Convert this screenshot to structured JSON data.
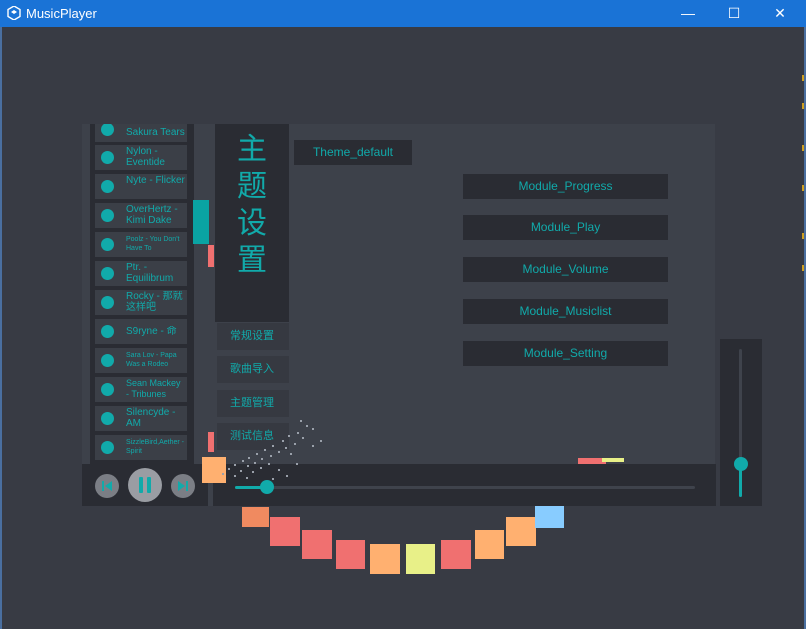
{
  "window": {
    "title": "MusicPlayer",
    "minimize_glyph": "—",
    "maximize_glyph": "☐",
    "close_glyph": "✕"
  },
  "music_list": {
    "items": [
      {
        "label": "Sakura Tears",
        "dot_color": "#11aaaa"
      },
      {
        "label": "Nylon - Eventide",
        "dot_color": "#11aaaa"
      },
      {
        "label": "Nyte - Flicker",
        "dot_color": "#11aaaa"
      },
      {
        "label": "OverHertz - Kimi Dake",
        "dot_color": "#11aaaa"
      },
      {
        "label": "Poolz - You Don't Have To",
        "dot_color": "#11aaaa"
      },
      {
        "label": "Ptr. - Equilibrum",
        "dot_color": "#11aaaa"
      },
      {
        "label": "Rocky - 那就这样吧",
        "dot_color": "#11aaaa"
      },
      {
        "label": "S9ryne - 命",
        "dot_color": "#11aaaa"
      },
      {
        "label": "Sara Lov - Papa Was a Rodeo",
        "dot_color": "#11aaaa"
      },
      {
        "label": "Sean Mackey - Tribunes",
        "dot_color": "#11aaaa"
      },
      {
        "label": "Silencyde - AM",
        "dot_color": "#11aaaa"
      },
      {
        "label": "SizzleBird,Aether - Spirit",
        "dot_color": "#11aaaa"
      }
    ]
  },
  "settings": {
    "panel_title": "主题设置",
    "nav": [
      "常规设置",
      "歌曲导入",
      "主题管理",
      "测试信息"
    ],
    "theme_button": "Theme_default",
    "modules": [
      "Module_Progress",
      "Module_Play",
      "Module_Volume",
      "Module_Musiclist",
      "Module_Setting"
    ]
  },
  "player": {
    "prev_icon": "prev-icon",
    "pause_icon": "pause-icon",
    "next_icon": "next-icon",
    "progress_fraction": 0.07,
    "volume_fraction": 0.22
  },
  "colors": {
    "accent": "#11aaaa",
    "panel_dark": "#2a2c33",
    "background": "#383b44",
    "titlebar": "#1a73d6"
  },
  "spectrum_colors": [
    "#f08a60",
    "#f07070",
    "#f07070",
    "#f07070",
    "#ffb070",
    "#e8f088",
    "#f07070",
    "#ffb070",
    "#ffb070",
    "#88ccff"
  ]
}
